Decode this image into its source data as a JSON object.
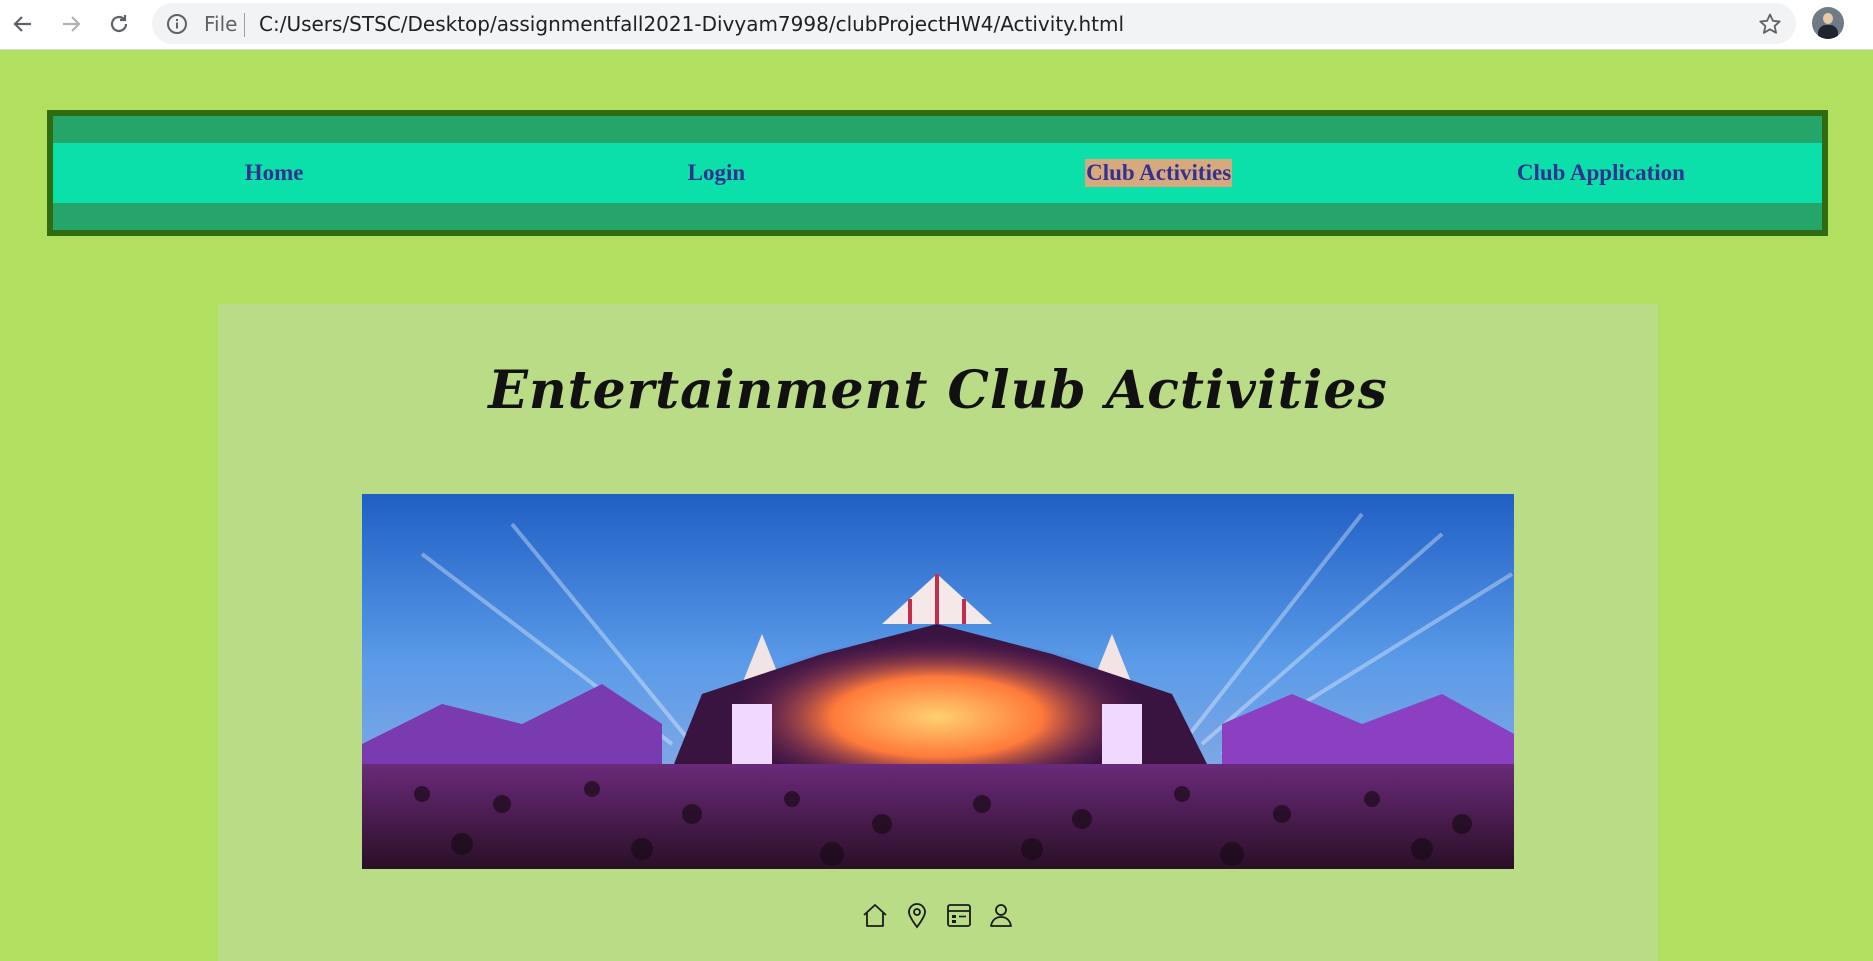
{
  "browser": {
    "scheme_label": "File",
    "url": "C:/Users/STSC/Desktop/assignmentfall2021-Divyam7998/clubProjectHW4/Activity.html"
  },
  "nav": {
    "items": [
      {
        "label": "Home",
        "active": false
      },
      {
        "label": "Login",
        "active": false
      },
      {
        "label": "Club Activities",
        "active": true
      },
      {
        "label": "Club Application",
        "active": false
      }
    ]
  },
  "main": {
    "title": "Entertainment Club Activities",
    "hero_image": "festival-stage-photo"
  },
  "footer": {
    "icons": [
      "home-icon",
      "location-icon",
      "calendar-icon",
      "user-icon"
    ]
  },
  "colors": {
    "page_bg": "#b1df5f",
    "nav_outer": "#25a56a",
    "nav_border": "#2f6b10",
    "nav_strip": "#0be0aa",
    "nav_text": "#33338f",
    "active_highlight": "#d8a97e",
    "panel_bg": "#bbdc86"
  }
}
